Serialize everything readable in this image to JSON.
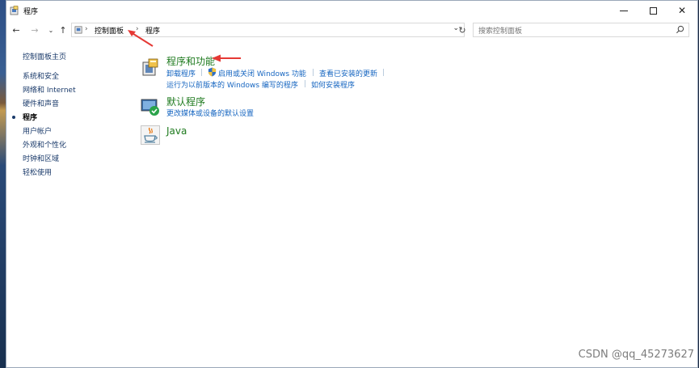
{
  "window": {
    "title": "程序"
  },
  "nav": {
    "back_icon": "back-arrow-icon",
    "forward_icon": "forward-arrow-icon",
    "recent_icon": "chevron-down-icon",
    "up_icon": "up-arrow-icon",
    "breadcrumb": [
      "控制面板",
      "程序"
    ],
    "search_placeholder": "搜索控制面板"
  },
  "sidebar": {
    "items": [
      {
        "label": "控制面板主页"
      },
      {
        "label": "系统和安全"
      },
      {
        "label": "网络和 Internet"
      },
      {
        "label": "硬件和声音"
      },
      {
        "label": "程序",
        "current": true
      },
      {
        "label": "用户帐户"
      },
      {
        "label": "外观和个性化"
      },
      {
        "label": "时钟和区域"
      },
      {
        "label": "轻松使用"
      }
    ]
  },
  "categories": [
    {
      "title": "程序和功能",
      "icon": "programs-features-icon",
      "links_row1": [
        "卸载程序",
        "启用或关闭 Windows 功能",
        "查看已安装的更新"
      ],
      "links_row2": [
        "运行为以前版本的 Windows 编写的程序",
        "如何安装程序"
      ]
    },
    {
      "title": "默认程序",
      "icon": "default-programs-icon",
      "links_row1": [
        "更改媒体或设备的默认设置"
      ]
    },
    {
      "title": "Java",
      "icon": "java-icon"
    }
  ],
  "watermark": "CSDN @qq_45273627",
  "colors": {
    "category_title": "#1e7a1e",
    "link": "#1565c0",
    "annotation_arrow": "#e53935"
  }
}
